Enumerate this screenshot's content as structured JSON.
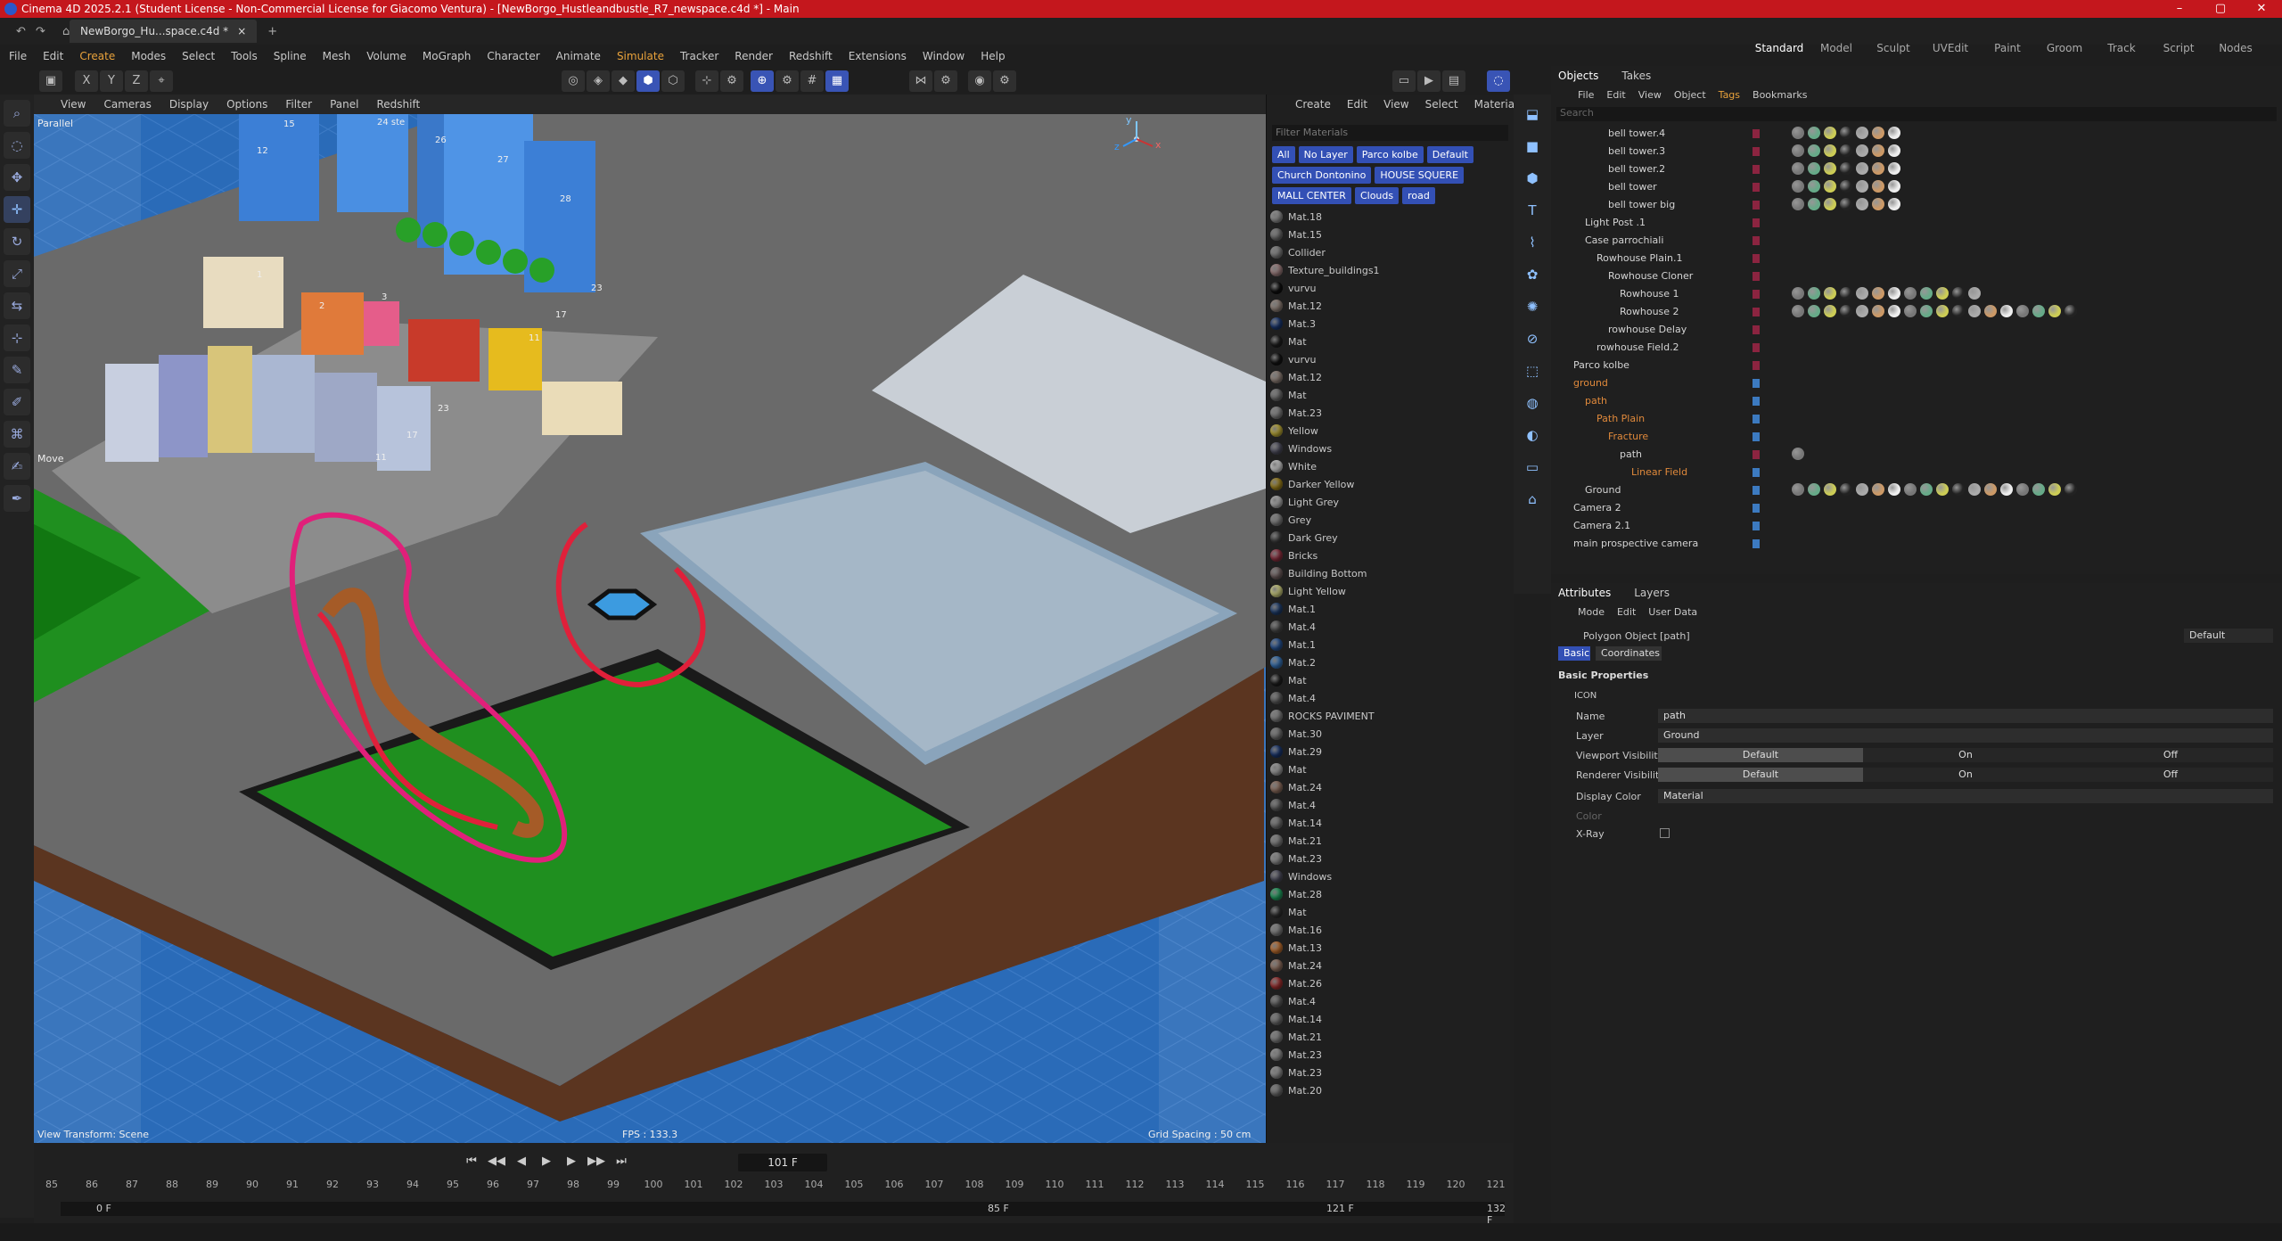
{
  "window": {
    "title": "Cinema 4D 2025.2.1 (Student License - Non-Commercial License for Giacomo Ventura) - [NewBorgo_Hustleandbustle_R7_newspace.c4d *] - Main",
    "minimize": "–",
    "maximize": "▢",
    "close": "✕"
  },
  "doc_tab": {
    "label": "NewBorgo_Hu...space.c4d *",
    "close": "×",
    "add": "+"
  },
  "layouts": [
    {
      "label": "Standard",
      "active": true
    },
    {
      "label": "Model"
    },
    {
      "label": "Sculpt"
    },
    {
      "label": "UVEdit"
    },
    {
      "label": "Paint"
    },
    {
      "label": "Groom"
    },
    {
      "label": "Track"
    },
    {
      "label": "Script"
    },
    {
      "label": "Nodes"
    }
  ],
  "menu": [
    {
      "label": "File"
    },
    {
      "label": "Edit"
    },
    {
      "label": "Create",
      "active": true
    },
    {
      "label": "Modes"
    },
    {
      "label": "Select"
    },
    {
      "label": "Tools"
    },
    {
      "label": "Spline"
    },
    {
      "label": "Mesh"
    },
    {
      "label": "Volume"
    },
    {
      "label": "MoGraph"
    },
    {
      "label": "Character"
    },
    {
      "label": "Animate"
    },
    {
      "label": "Simulate",
      "active": true
    },
    {
      "label": "Tracker"
    },
    {
      "label": "Render"
    },
    {
      "label": "Redshift"
    },
    {
      "label": "Extensions"
    },
    {
      "label": "Window"
    },
    {
      "label": "Help"
    }
  ],
  "axis_buttons": [
    "X",
    "Y",
    "Z"
  ],
  "viewport": {
    "menu": [
      "View",
      "Cameras",
      "Display",
      "Options",
      "Filter",
      "Panel",
      "Redshift"
    ],
    "projection": "Parallel",
    "tool_label": "Move",
    "view_transform": "View Transform: Scene",
    "fps": "FPS : 133.3",
    "grid_spacing": "Grid Spacing : 50 cm",
    "axis_y": "y",
    "axis_x": "x",
    "axis_z": "z",
    "building_labels": [
      "15",
      "12",
      "24 ste",
      "26",
      "27",
      "28",
      "23",
      "17",
      "11",
      "2",
      "1",
      "3",
      "23",
      "17",
      "11"
    ]
  },
  "timeline": {
    "current_frame": "101 F",
    "ticks": [
      "85",
      "86",
      "87",
      "88",
      "89",
      "90",
      "91",
      "92",
      "93",
      "94",
      "95",
      "96",
      "97",
      "98",
      "99",
      "100",
      "101",
      "102",
      "103",
      "104",
      "105",
      "106",
      "107",
      "108",
      "109",
      "110",
      "111",
      "112",
      "113",
      "114",
      "115",
      "116",
      "117",
      "118",
      "119",
      "120",
      "121"
    ],
    "range_start": "0 F",
    "range_mid_start": "85 F",
    "range_mid_end": "121 F",
    "range_end": "132 F"
  },
  "materials": {
    "menu": [
      "Create",
      "Edit",
      "View",
      "Select",
      "Material"
    ],
    "filter_placeholder": "Filter Materials",
    "chips": [
      "All",
      "No Layer",
      "Parco kolbe",
      "Default",
      "Church Dontonino",
      "HOUSE SQUERE",
      "MALL CENTER",
      "Clouds",
      "road"
    ],
    "items": [
      {
        "name": "Mat.18",
        "color": "#9a9a9a"
      },
      {
        "name": "Mat.15",
        "color": "#777"
      },
      {
        "name": "Collider",
        "color": "#888"
      },
      {
        "name": "Texture_buildings1",
        "color": "#a88"
      },
      {
        "name": "vurvu",
        "color": "#111"
      },
      {
        "name": "Mat.12",
        "color": "#9a8a80"
      },
      {
        "name": "Mat.3",
        "color": "#1d3c7a"
      },
      {
        "name": "Mat",
        "color": "#222"
      },
      {
        "name": "vurvu",
        "color": "#151515"
      },
      {
        "name": "Mat.12",
        "color": "#9a8a80"
      },
      {
        "name": "Mat",
        "color": "#777"
      },
      {
        "name": "Mat.23",
        "color": "#888"
      },
      {
        "name": "Yellow",
        "color": "#c9b53a"
      },
      {
        "name": "Windows",
        "color": "#556"
      },
      {
        "name": "White",
        "color": "#ddd"
      },
      {
        "name": "Darker Yellow",
        "color": "#a88a1d"
      },
      {
        "name": "Light Grey",
        "color": "#bbb"
      },
      {
        "name": "Grey",
        "color": "#888"
      },
      {
        "name": "Dark Grey",
        "color": "#444"
      },
      {
        "name": "Bricks",
        "color": "#934"
      },
      {
        "name": "Building Bottom",
        "color": "#766"
      },
      {
        "name": "Light Yellow",
        "color": "#dd8"
      },
      {
        "name": "Mat.1",
        "color": "#247"
      },
      {
        "name": "Mat.4",
        "color": "#555"
      },
      {
        "name": "Mat.1",
        "color": "#2a5aa0"
      },
      {
        "name": "Mat.2",
        "color": "#3a7ac0"
      },
      {
        "name": "Mat",
        "color": "#222"
      },
      {
        "name": "Mat.4",
        "color": "#666"
      },
      {
        "name": "ROCKS PAVIMENT",
        "color": "#888"
      },
      {
        "name": "Mat.30",
        "color": "#777"
      },
      {
        "name": "Mat.29",
        "color": "#1d3c7a"
      },
      {
        "name": "Mat",
        "color": "#aaa"
      },
      {
        "name": "Mat.24",
        "color": "#976"
      },
      {
        "name": "Mat.4",
        "color": "#666"
      },
      {
        "name": "Mat.14",
        "color": "#777"
      },
      {
        "name": "Mat.21",
        "color": "#888"
      },
      {
        "name": "Mat.23",
        "color": "#999"
      },
      {
        "name": "Windows",
        "color": "#556"
      },
      {
        "name": "Mat.28",
        "color": "#2a6"
      },
      {
        "name": "Mat",
        "color": "#333"
      },
      {
        "name": "Mat.16",
        "color": "#888"
      },
      {
        "name": "Mat.13",
        "color": "#c73"
      },
      {
        "name": "Mat.24",
        "color": "#976"
      },
      {
        "name": "Mat.26",
        "color": "#a33"
      },
      {
        "name": "Mat.4",
        "color": "#666"
      },
      {
        "name": "Mat.14",
        "color": "#777"
      },
      {
        "name": "Mat.21",
        "color": "#888"
      },
      {
        "name": "Mat.23",
        "color": "#999"
      },
      {
        "name": "Mat.23",
        "color": "#999"
      },
      {
        "name": "Mat.20",
        "color": "#777"
      }
    ]
  },
  "objects": {
    "tabs": [
      "Objects",
      "Takes"
    ],
    "menu": [
      "File",
      "Edit",
      "View",
      "Object",
      "Tags",
      "Bookmarks"
    ],
    "search_placeholder": "Search",
    "items": [
      {
        "name": "bell tower.4",
        "indent": 4,
        "tags": 7
      },
      {
        "name": "bell tower.3",
        "indent": 4,
        "tags": 7
      },
      {
        "name": "bell tower.2",
        "indent": 4,
        "tags": 7
      },
      {
        "name": "bell tower",
        "indent": 4,
        "tags": 7
      },
      {
        "name": "bell tower big",
        "indent": 4,
        "tags": 7
      },
      {
        "name": "Light Post .1",
        "indent": 2,
        "tags": 0
      },
      {
        "name": "Case parrochiali",
        "indent": 2,
        "tags": 0
      },
      {
        "name": "Rowhouse Plain.1",
        "indent": 3,
        "tags": 0
      },
      {
        "name": "Rowhouse Cloner",
        "indent": 4,
        "tags": 0
      },
      {
        "name": "Rowhouse 1",
        "indent": 5,
        "tags": 12
      },
      {
        "name": "Rowhouse 2",
        "indent": 5,
        "tags": 18
      },
      {
        "name": "rowhouse Delay",
        "indent": 4,
        "tags": 0
      },
      {
        "name": "rowhouse  Field.2",
        "indent": 3,
        "tags": 0
      },
      {
        "name": "Parco kolbe",
        "indent": 1,
        "tags": 0
      },
      {
        "name": "ground",
        "indent": 1,
        "orange": true,
        "tags": 0
      },
      {
        "name": "path",
        "indent": 2,
        "orange": true,
        "tags": 0
      },
      {
        "name": "Path Plain",
        "indent": 3,
        "orange": true,
        "tags": 0
      },
      {
        "name": "Fracture",
        "indent": 4,
        "orange": true,
        "tags": 0
      },
      {
        "name": "path",
        "indent": 5,
        "tags": 1
      },
      {
        "name": "Linear Field",
        "indent": 6,
        "orange": true,
        "tags": 0
      },
      {
        "name": "Ground",
        "indent": 2,
        "tags": 20
      },
      {
        "name": "Camera 2",
        "indent": 1,
        "tags": 0
      },
      {
        "name": "Camera 2.1",
        "indent": 1,
        "tags": 0
      },
      {
        "name": "main prospective camera",
        "indent": 1,
        "tags": 0
      }
    ]
  },
  "attributes": {
    "tabs": [
      "Attributes",
      "Layers"
    ],
    "menu": [
      "Mode",
      "Edit",
      "User Data"
    ],
    "object_label": "Polygon Object [path]",
    "preset": "Default",
    "subtabs": [
      "Basic",
      "Coordinates"
    ],
    "section": "Basic Properties",
    "icon_label": "ICON",
    "name_label": "Name",
    "name_value": "path",
    "layer_label": "Layer",
    "layer_value": "Ground",
    "viewport_vis_label": "Viewport Visibility",
    "renderer_vis_label": "Renderer Visibility",
    "vis_options": [
      "Default",
      "On",
      "Off"
    ],
    "display_color_label": "Display Color",
    "display_color_value": "Material",
    "color_label": "Color",
    "xray_label": "X-Ray"
  }
}
